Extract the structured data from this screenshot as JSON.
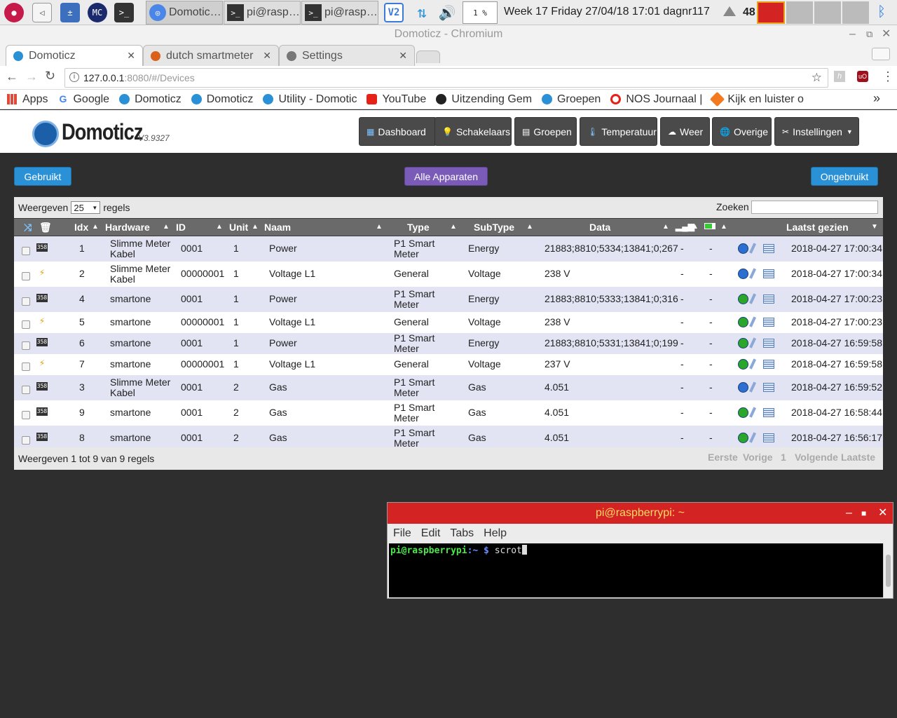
{
  "taskbar": {
    "tasks": [
      "Domotic…",
      "pi@rasp…",
      "pi@rasp…"
    ],
    "cpu": "1 %",
    "clock": "Week 17 Friday 27/04/18 17:01 dagnr117",
    "temp": "48"
  },
  "browser": {
    "window_title": "Domoticz - Chromium",
    "tabs": [
      {
        "label": "Domoticz",
        "active": true
      },
      {
        "label": "dutch smartmeter",
        "active": false
      },
      {
        "label": "Settings",
        "active": false
      }
    ],
    "url_host": "127.0.0.1",
    "url_rest": ":8080/#/Devices",
    "bookmarks": [
      "Apps",
      "Google",
      "Domoticz",
      "Domoticz",
      "Utility - Domotic",
      "YouTube",
      "Uitzending Gem",
      "Groepen",
      "NOS Journaal |",
      "Kijk en luister o"
    ],
    "overflow": "»"
  },
  "app": {
    "logo": "Domoticz",
    "version": "V3.9327",
    "nav": [
      "Dashboard",
      "Schakelaars",
      "Groepen",
      "Temperatuur",
      "Weer",
      "Overige",
      "Instellingen"
    ],
    "buttons": {
      "used": "Gebruikt",
      "all": "Alle Apparaten",
      "unused": "Ongebruikt"
    }
  },
  "table": {
    "show_label": "Weergeven",
    "page_size": "25",
    "rows_label": "regels",
    "search_label": "Zoeken :",
    "columns": {
      "idx": "Idx",
      "hardware": "Hardware",
      "id": "ID",
      "unit": "Unit",
      "name": "Naam",
      "type": "Type",
      "subtype": "SubType",
      "data": "Data",
      "last_seen": "Laatst gezien"
    },
    "rows": [
      {
        "idx": "1",
        "hardware": [
          "Slimme Meter",
          "Kabel"
        ],
        "id": "0001",
        "unit": "1",
        "name": "Power",
        "type": [
          "P1 Smart",
          "Meter"
        ],
        "subtype": "Energy",
        "data": "21883;8810;5334;13841;0;267",
        "sig": "-",
        "bat": "-",
        "last": "2018-04-27 17:00:34",
        "icon": "meter",
        "go": "blue"
      },
      {
        "idx": "2",
        "hardware": [
          "Slimme Meter",
          "Kabel"
        ],
        "id": "00000001",
        "unit": "1",
        "name": "Voltage L1",
        "type": [
          "General"
        ],
        "subtype": "Voltage",
        "data": "238 V",
        "sig": "-",
        "bat": "-",
        "last": "2018-04-27 17:00:34",
        "icon": "bolt",
        "go": "blue"
      },
      {
        "idx": "4",
        "hardware": [
          "smartone"
        ],
        "id": "0001",
        "unit": "1",
        "name": "Power",
        "type": [
          "P1 Smart",
          "Meter"
        ],
        "subtype": "Energy",
        "data": "21883;8810;5333;13841;0;316",
        "sig": "-",
        "bat": "-",
        "last": "2018-04-27 17:00:23",
        "icon": "meter",
        "go": "green"
      },
      {
        "idx": "5",
        "hardware": [
          "smartone"
        ],
        "id": "00000001",
        "unit": "1",
        "name": "Voltage L1",
        "type": [
          "General"
        ],
        "subtype": "Voltage",
        "data": "238 V",
        "sig": "-",
        "bat": "-",
        "last": "2018-04-27 17:00:23",
        "icon": "bolt",
        "go": "green"
      },
      {
        "idx": "6",
        "hardware": [
          "smartone"
        ],
        "id": "0001",
        "unit": "1",
        "name": "Power",
        "type": [
          "P1 Smart",
          "Meter"
        ],
        "subtype": "Energy",
        "data": "21883;8810;5331;13841;0;199",
        "sig": "-",
        "bat": "-",
        "last": "2018-04-27 16:59:58",
        "icon": "meter",
        "go": "green"
      },
      {
        "idx": "7",
        "hardware": [
          "smartone"
        ],
        "id": "00000001",
        "unit": "1",
        "name": "Voltage L1",
        "type": [
          "General"
        ],
        "subtype": "Voltage",
        "data": "237 V",
        "sig": "-",
        "bat": "-",
        "last": "2018-04-27 16:59:58",
        "icon": "bolt",
        "go": "green"
      },
      {
        "idx": "3",
        "hardware": [
          "Slimme Meter",
          "Kabel"
        ],
        "id": "0001",
        "unit": "2",
        "name": "Gas",
        "type": [
          "P1 Smart",
          "Meter"
        ],
        "subtype": "Gas",
        "data": "4.051",
        "sig": "-",
        "bat": "-",
        "last": "2018-04-27 16:59:52",
        "icon": "meter",
        "go": "blue"
      },
      {
        "idx": "9",
        "hardware": [
          "smartone"
        ],
        "id": "0001",
        "unit": "2",
        "name": "Gas",
        "type": [
          "P1 Smart",
          "Meter"
        ],
        "subtype": "Gas",
        "data": "4.051",
        "sig": "-",
        "bat": "-",
        "last": "2018-04-27 16:58:44",
        "icon": "meter",
        "go": "green"
      },
      {
        "idx": "8",
        "hardware": [
          "smartone"
        ],
        "id": "0001",
        "unit": "2",
        "name": "Gas",
        "type": [
          "P1 Smart",
          "Meter"
        ],
        "subtype": "Gas",
        "data": "4.051",
        "sig": "-",
        "bat": "-",
        "last": "2018-04-27 16:56:17",
        "icon": "meter",
        "go": "green"
      }
    ],
    "footer": "Weergeven 1 tot 9 van 9 regels",
    "pager": [
      "Eerste",
      "Vorige",
      "1",
      "Volgende",
      "Laatste"
    ]
  },
  "terminal": {
    "title": "pi@raspberrypi: ~",
    "menu": [
      "File",
      "Edit",
      "Tabs",
      "Help"
    ],
    "prompt_user": "pi@raspberrypi",
    "prompt_path": ":~ $",
    "command": "scrot"
  },
  "colors": {
    "accent_blue": "#2a91d6",
    "accent_purple": "#7a5cb8",
    "terminal_red": "#d42323"
  }
}
